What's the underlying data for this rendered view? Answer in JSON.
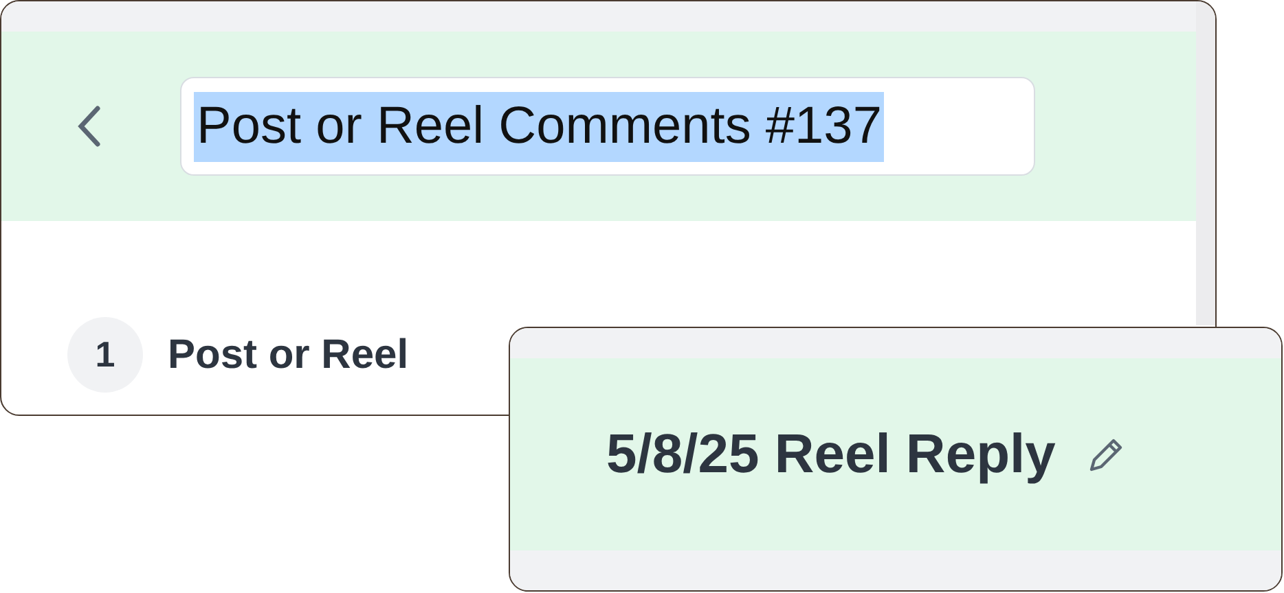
{
  "main_card": {
    "title_field": {
      "value": "Post or Reel Comments #137",
      "highlighted": true
    },
    "step": {
      "number": "1",
      "label": "Post or Reel"
    }
  },
  "reply_card": {
    "title": "5/8/25 Reel Reply"
  }
}
